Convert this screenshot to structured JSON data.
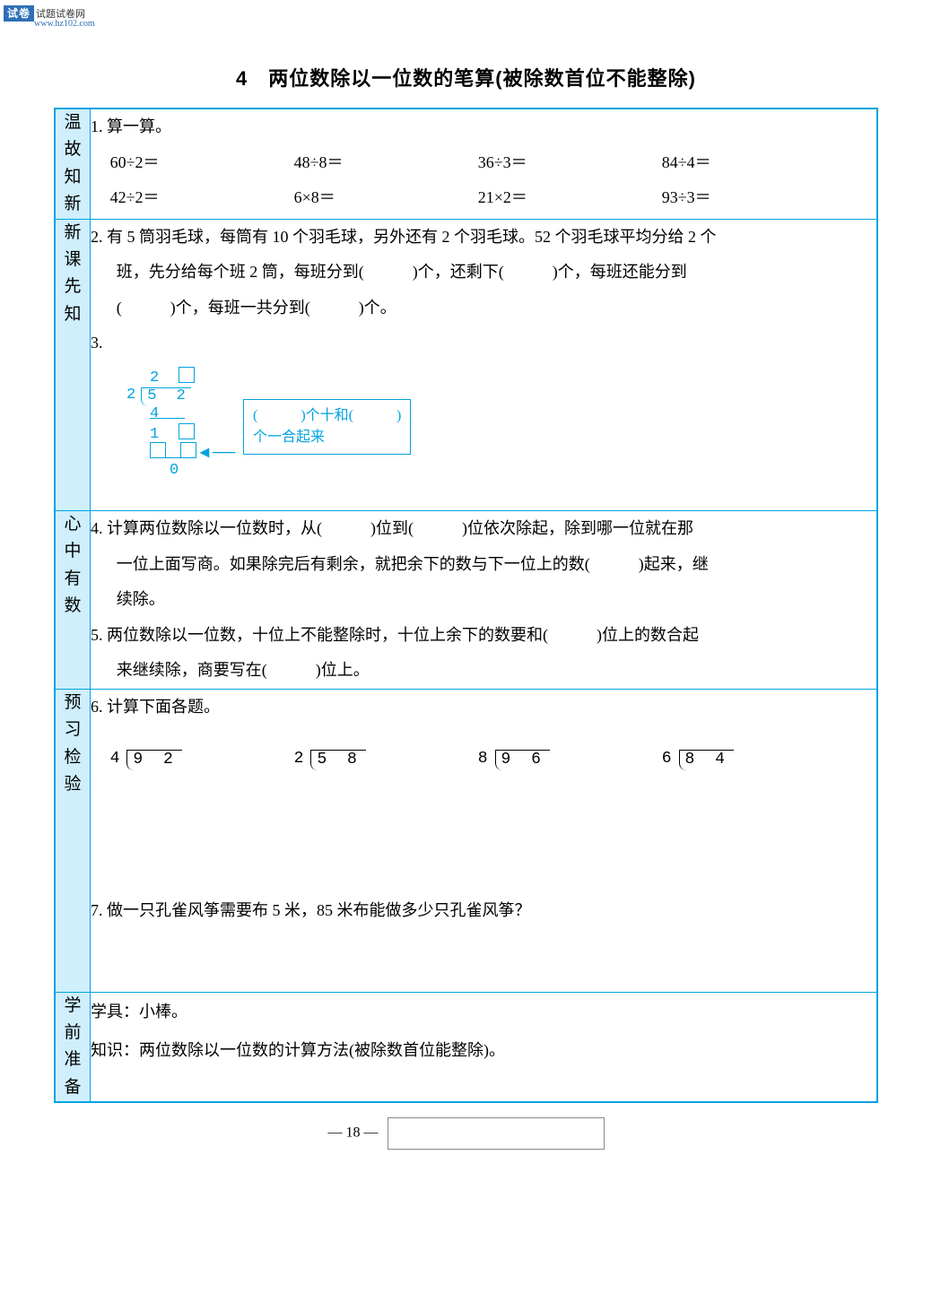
{
  "watermark": {
    "badge": "试卷",
    "text1": "试题试卷网",
    "text2": "www.hz102.com"
  },
  "title": "4　两位数除以一位数的笔算(被除数首位不能整除)",
  "sections": {
    "s1": {
      "label": "温故知新"
    },
    "s2": {
      "label": "新课先知"
    },
    "s3": {
      "label": "心中有数"
    },
    "s4": {
      "label": "预习检验"
    },
    "s5": {
      "label": "学前准备"
    }
  },
  "q1": {
    "title": "1. 算一算。",
    "items": [
      "60÷2＝",
      "48÷8＝",
      "36÷3＝",
      "84÷4＝",
      "42÷2＝",
      "6×8＝",
      "21×2＝",
      "93÷3＝"
    ]
  },
  "q2": {
    "line1": "2. 有 5 筒羽毛球，每筒有 10 个羽毛球，另外还有 2 个羽毛球。52 个羽毛球平均分给 2 个",
    "line2": "班，先分给每个班 2 筒，每班分到(　　　)个，还剩下(　　　)个，每班还能分到",
    "line3": "(　　　)个，每班一共分到(　　　)个。"
  },
  "q3": {
    "title": "3.",
    "quotient_tens": "2",
    "divisor": "2",
    "dividend": "5 2",
    "sub1": "4",
    "rem_tens": "1",
    "final": "0",
    "note_top": "(　　　)个十和(　　　)",
    "note_bottom": "个一合起来"
  },
  "q4": {
    "line1": "4. 计算两位数除以一位数时，从(　　　)位到(　　　)位依次除起，除到哪一位就在那",
    "line2": "一位上面写商。如果除完后有剩余，就把余下的数与下一位上的数(　　　)起来，继",
    "line3": "续除。"
  },
  "q5": {
    "line1": "5. 两位数除以一位数，十位上不能整除时，十位上余下的数要和(　　　)位上的数合起",
    "line2": "来继续除，商要写在(　　　)位上。"
  },
  "q6": {
    "title": "6. 计算下面各题。",
    "items": [
      {
        "divisor": "4",
        "dividend": "9 2"
      },
      {
        "divisor": "2",
        "dividend": "5 8"
      },
      {
        "divisor": "8",
        "dividend": "9 6"
      },
      {
        "divisor": "6",
        "dividend": "8 4"
      }
    ]
  },
  "q7": {
    "text": "7. 做一只孔雀风筝需要布 5 米，85 米布能做多少只孔雀风筝？"
  },
  "prep": {
    "line1": "学具：小棒。",
    "line2": "知识：两位数除以一位数的计算方法(被除数首位能整除)。"
  },
  "pageNumber": "—  18  —"
}
